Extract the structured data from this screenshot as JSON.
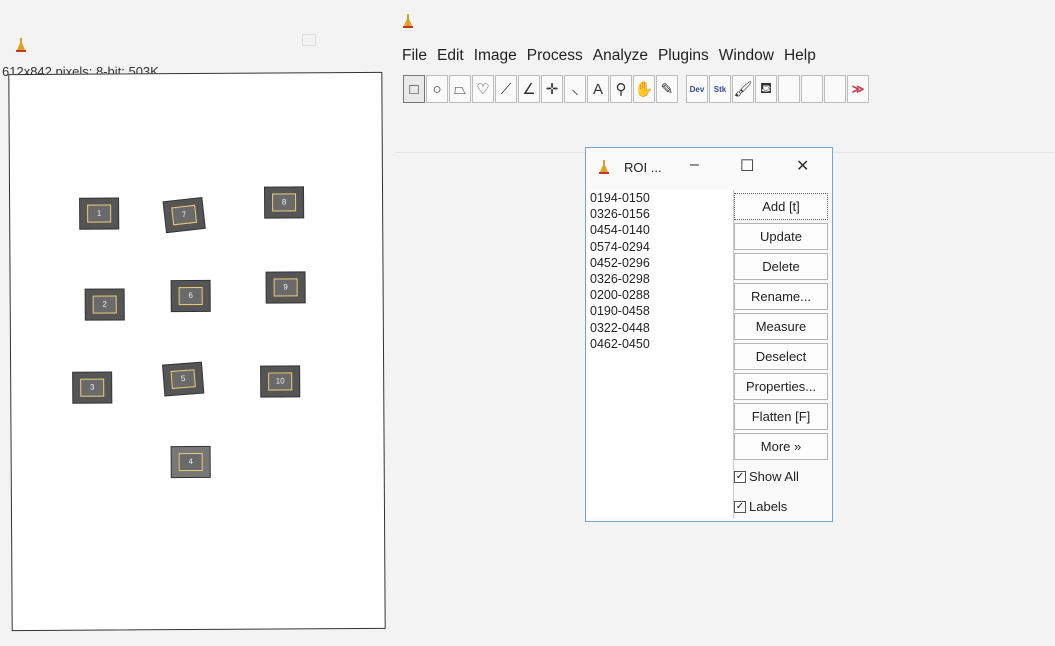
{
  "image_window": {
    "info": "612x842 pixels; 8-bit; 503K",
    "rois": [
      {
        "label": "1"
      },
      {
        "label": "7"
      },
      {
        "label": "8"
      },
      {
        "label": "2"
      },
      {
        "label": "6"
      },
      {
        "label": "9"
      },
      {
        "label": "3"
      },
      {
        "label": "5"
      },
      {
        "label": "10"
      },
      {
        "label": "4"
      }
    ]
  },
  "main_window": {
    "menu": [
      "File",
      "Edit",
      "Image",
      "Process",
      "Analyze",
      "Plugins",
      "Window",
      "Help"
    ],
    "tools": [
      {
        "icon": "rectangle-tool-icon",
        "glyph": "□"
      },
      {
        "icon": "oval-tool-icon",
        "glyph": "○"
      },
      {
        "icon": "polygon-tool-icon",
        "glyph": "⏢"
      },
      {
        "icon": "freehand-tool-icon",
        "glyph": "♡"
      },
      {
        "icon": "line-tool-icon",
        "glyph": "⟋"
      },
      {
        "icon": "angle-tool-icon",
        "glyph": "∠"
      },
      {
        "icon": "point-tool-icon",
        "glyph": "✛"
      },
      {
        "icon": "wand-tool-icon",
        "glyph": "⸜"
      },
      {
        "icon": "text-tool-icon",
        "glyph": "A"
      },
      {
        "icon": "magnifier-tool-icon",
        "glyph": "⚲"
      },
      {
        "icon": "hand-tool-icon",
        "glyph": "✋"
      },
      {
        "icon": "color-picker-tool-icon",
        "glyph": "✎"
      },
      {
        "icon": "dev-tool-icon",
        "glyph": "Dev"
      },
      {
        "icon": "stk-tool-icon",
        "glyph": "Stk"
      },
      {
        "icon": "brush-tool-icon",
        "glyph": "🖌"
      },
      {
        "icon": "flood-fill-tool-icon",
        "glyph": "⛾"
      },
      {
        "icon": "empty-tool-icon",
        "glyph": ""
      },
      {
        "icon": "empty-tool-icon",
        "glyph": ""
      },
      {
        "icon": "empty-tool-icon",
        "glyph": ""
      },
      {
        "icon": "more-tools-icon",
        "glyph": "≫"
      }
    ]
  },
  "roi_manager": {
    "title": "ROI ...",
    "minimize": "–",
    "maximize": "☐",
    "close": "✕",
    "entries": [
      "0194-0150",
      "0326-0156",
      "0454-0140",
      "0574-0294",
      "0452-0296",
      "0326-0298",
      "0200-0288",
      "0190-0458",
      "0322-0448",
      "0462-0450"
    ],
    "buttons": [
      "Add [t]",
      "Update",
      "Delete",
      "Rename...",
      "Measure",
      "Deselect",
      "Properties...",
      "Flatten [F]",
      "More »"
    ],
    "checkboxes": [
      {
        "label": "Show All",
        "checked": true
      },
      {
        "label": "Labels",
        "checked": true
      }
    ]
  },
  "colors": {
    "roi_outline": "#e6cc7a",
    "more_arrow": "#c8364b",
    "window_border": "#7aa1c9"
  }
}
